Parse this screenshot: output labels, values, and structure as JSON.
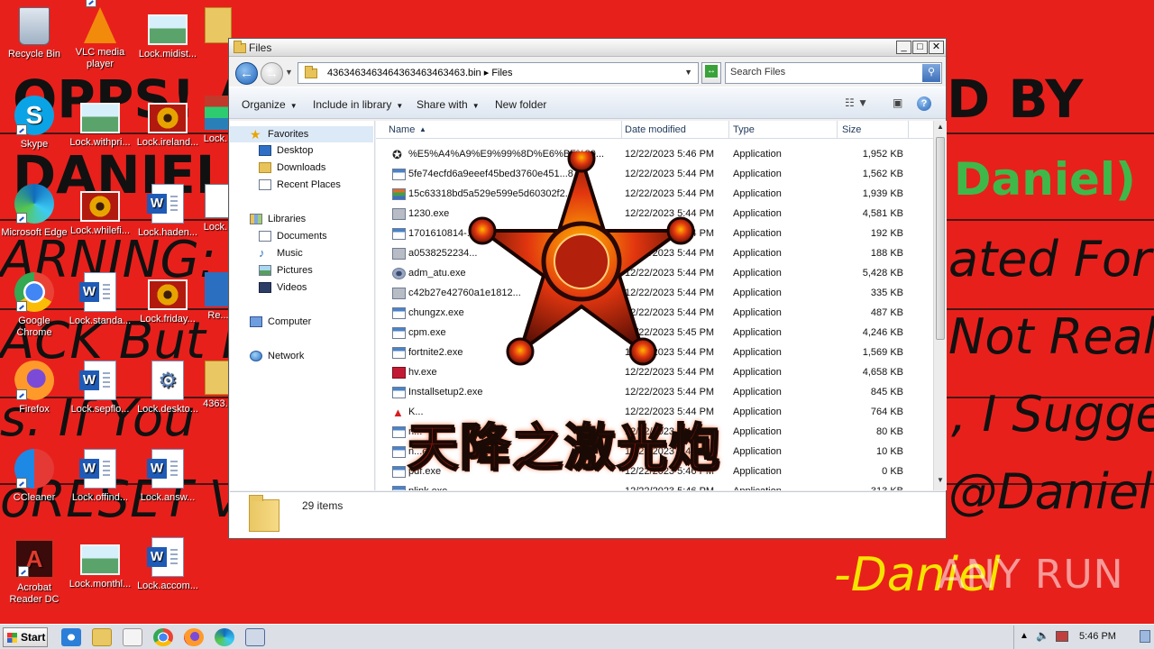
{
  "wallpaper": {
    "lines": [
      {
        "text": "OPPS! A",
        "right": "D BY"
      },
      {
        "text": "DANIEL",
        "right": "Daniel)"
      },
      {
        "text": "ARNING:",
        "right": "ated For"
      },
      {
        "text": "ACK But F",
        "right": "Not Real"
      },
      {
        "text": "s. If You",
        "right": ", I Sugge"
      },
      {
        "text": "oRESET V",
        "right": "@Daniel"
      },
      {
        "text": "",
        "right": "-Daniel"
      }
    ]
  },
  "desktop_icons": [
    {
      "label": "Recycle Bin",
      "icon": "recycle-bin-icon"
    },
    {
      "label": "VLC media player",
      "icon": "vlc-icon"
    },
    {
      "label": "Lock.midist...",
      "icon": "image-file-icon"
    },
    {
      "label": "Skype",
      "icon": "skype-icon"
    },
    {
      "label": "Lock.withpri...",
      "icon": "image-file-icon"
    },
    {
      "label": "Lock.ireland...",
      "icon": "image-file-icon"
    },
    {
      "label": "Lock...",
      "icon": "file-icon"
    },
    {
      "label": "Microsoft Edge",
      "icon": "edge-icon"
    },
    {
      "label": "Lock.whilefi...",
      "icon": "image-file-icon"
    },
    {
      "label": "Lock.haden...",
      "icon": "word-doc-icon"
    },
    {
      "label": "Lock...",
      "icon": "file-icon"
    },
    {
      "label": "Google Chrome",
      "icon": "chrome-icon"
    },
    {
      "label": "Lock.standa...",
      "icon": "word-doc-icon"
    },
    {
      "label": "Lock.friday...",
      "icon": "image-file-icon"
    },
    {
      "label": "Re...",
      "icon": "file-icon"
    },
    {
      "label": "Firefox",
      "icon": "firefox-icon"
    },
    {
      "label": "Lock.sepflo...",
      "icon": "word-doc-icon"
    },
    {
      "label": "Lock.deskto...",
      "icon": "settings-file-icon"
    },
    {
      "label": "4363...",
      "icon": "folder-icon"
    },
    {
      "label": "CCleaner",
      "icon": "ccleaner-icon"
    },
    {
      "label": "Lock.offind...",
      "icon": "word-doc-icon"
    },
    {
      "label": "Lock.answ...",
      "icon": "word-doc-icon"
    },
    {
      "label": "Acrobat Reader DC",
      "icon": "acrobat-icon"
    },
    {
      "label": "Lock.monthl...",
      "icon": "image-file-icon"
    },
    {
      "label": "Lock.accom...",
      "icon": "word-doc-icon"
    }
  ],
  "window": {
    "title": "Files",
    "breadcrumb": [
      "4363463463464363463463463.bin",
      "Files"
    ],
    "search_placeholder": "Search Files",
    "commands": [
      "Organize",
      "Include in library",
      "Share with",
      "New folder"
    ],
    "nav": {
      "favorites": "Favorites",
      "desktop": "Desktop",
      "downloads": "Downloads",
      "recent": "Recent Places",
      "libraries": "Libraries",
      "documents": "Documents",
      "music": "Music",
      "pictures": "Pictures",
      "videos": "Videos",
      "computer": "Computer",
      "network": "Network"
    },
    "columns": [
      "Name",
      "Date modified",
      "Type",
      "Size"
    ],
    "files": [
      {
        "name": "%E5%A4%A9%E9%99%8D%E6%BF%80...",
        "date": "12/22/2023 5:46 PM",
        "type": "Application",
        "size": "1,952 KB",
        "icon": "star-app-icon"
      },
      {
        "name": "5fe74ecfd6a9eeef45bed3760e451...8...",
        "date": "12/22/2023 5:44 PM",
        "type": "Application",
        "size": "1,562 KB",
        "icon": "exe-icon"
      },
      {
        "name": "15c63318bd5a529e599e5d60302f2...1...",
        "date": "12/22/2023 5:44 PM",
        "type": "Application",
        "size": "1,939 KB",
        "icon": "colored-bars-icon"
      },
      {
        "name": "1230.exe",
        "date": "12/22/2023 5:44 PM",
        "type": "Application",
        "size": "4,581 KB",
        "icon": "gray-app-icon"
      },
      {
        "name": "1701610814-...",
        "date": "12/22/2023 5:44 PM",
        "type": "Application",
        "size": "192 KB",
        "icon": "exe-icon"
      },
      {
        "name": "a0538252234...",
        "date": "12/22/2023 5:44 PM",
        "type": "Application",
        "size": "188 KB",
        "icon": "gray-app-icon"
      },
      {
        "name": "adm_atu.exe",
        "date": "12/22/2023 5:44 PM",
        "type": "Application",
        "size": "5,428 KB",
        "icon": "gear-app-icon"
      },
      {
        "name": "c42b27e42760a1e1812...",
        "date": "12/22/2023 5:44 PM",
        "type": "Application",
        "size": "335 KB",
        "icon": "gray-app-icon"
      },
      {
        "name": "chungzx.exe",
        "date": "12/22/2023 5:44 PM",
        "type": "Application",
        "size": "487 KB",
        "icon": "exe-icon"
      },
      {
        "name": "cpm.exe",
        "date": "12/22/2023 5:45 PM",
        "type": "Application",
        "size": "4,246 KB",
        "icon": "exe-icon"
      },
      {
        "name": "fortnite2.exe",
        "date": "12/22/2023 5:44 PM",
        "type": "Application",
        "size": "1,569 KB",
        "icon": "exe-icon"
      },
      {
        "name": "hv.exe",
        "date": "12/22/2023 5:44 PM",
        "type": "Application",
        "size": "4,658 KB",
        "icon": "red-app-icon"
      },
      {
        "name": "Installsetup2.exe",
        "date": "12/22/2023 5:44 PM",
        "type": "Application",
        "size": "845 KB",
        "icon": "exe-icon"
      },
      {
        "name": "K...",
        "date": "12/22/2023 5:44 PM",
        "type": "Application",
        "size": "764 KB",
        "icon": "warning-icon"
      },
      {
        "name": "n...",
        "date": "12/22/2023 5:44 PM",
        "type": "Application",
        "size": "80 KB",
        "icon": "exe-icon"
      },
      {
        "name": "n...exe",
        "date": "12/22/2023 5:44 PM",
        "type": "Application",
        "size": "10 KB",
        "icon": "exe-icon"
      },
      {
        "name": "pdf.exe",
        "date": "12/22/2023 5:46 PM",
        "type": "Application",
        "size": "0 KB",
        "icon": "exe-icon"
      },
      {
        "name": "plink.exe",
        "date": "12/22/2023 5:46 PM",
        "type": "Application",
        "size": "313 KB",
        "icon": "exe-icon"
      }
    ],
    "item_count": "29 items"
  },
  "overlay_text": "天降之激光炮",
  "watermark": "ANY RUN",
  "taskbar": {
    "start_label": "Start",
    "pinned": [
      "ie-icon",
      "explorer-icon",
      "media-player-icon",
      "chrome-icon",
      "firefox-icon",
      "edge-icon",
      "network-app-icon"
    ],
    "clock": "5:46 PM"
  },
  "colors": {
    "wallpaper": "#e8201c",
    "wallpaper_accent": "#3fb84a",
    "wallpaper_yellow": "#f5e400"
  }
}
